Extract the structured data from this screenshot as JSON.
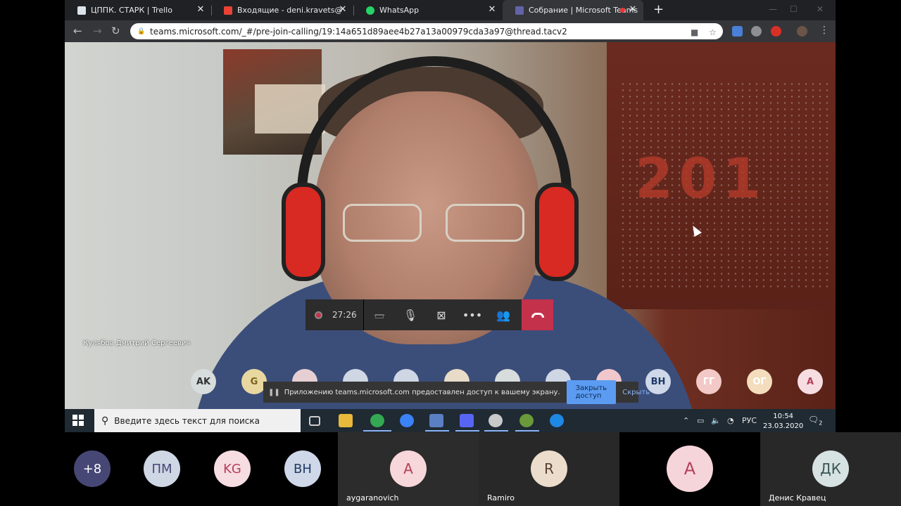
{
  "browser": {
    "tabs": [
      {
        "title": "ЦППК. СТАРК | Trello",
        "active": false
      },
      {
        "title": "Входящие - deni.kravets@gmail.",
        "active": false
      },
      {
        "title": "WhatsApp",
        "active": false
      },
      {
        "title": "Собрание | Microsoft Teams",
        "active": true
      }
    ],
    "url": "teams.microsoft.com/_#/pre-join-calling/19:14a651d89aee4b27a13a00979cda3a97@thread.tacv2"
  },
  "video": {
    "speaker_name": "Кулябов Дмитрий Сергеевич",
    "call_timer": "27:26",
    "participants": [
      "AK",
      "G",
      "",
      "",
      "",
      "",
      "",
      "",
      "",
      "ВН",
      "ГГ",
      "ОГ",
      "А"
    ],
    "share_notice": "Приложению teams.microsoft.com предоставлен доступ к вашему экрану.",
    "stop_sharing_label": "Закрыть доступ",
    "hide_label": "Скрыть"
  },
  "taskbar": {
    "search_placeholder": "Введите здесь текст для поиска",
    "lang": "РУС",
    "time": "10:54",
    "date": "23.03.2020",
    "notifications": "2"
  },
  "gallery": {
    "overflow": [
      {
        "initials": "+8"
      },
      {
        "initials": "ПМ"
      },
      {
        "initials": "KG"
      },
      {
        "initials": "ВН"
      }
    ],
    "tiles": [
      {
        "initials": "A",
        "name": "aygaranovich"
      },
      {
        "initials": "R",
        "name": "Ramiro"
      },
      {
        "initials": "A",
        "name": ""
      },
      {
        "initials": "ДК",
        "name": "Денис Кравец"
      }
    ]
  },
  "colors": {
    "teams_hangup": "#c4314b",
    "share_button": "#5b9cf2",
    "chrome_dark": "#202124"
  }
}
